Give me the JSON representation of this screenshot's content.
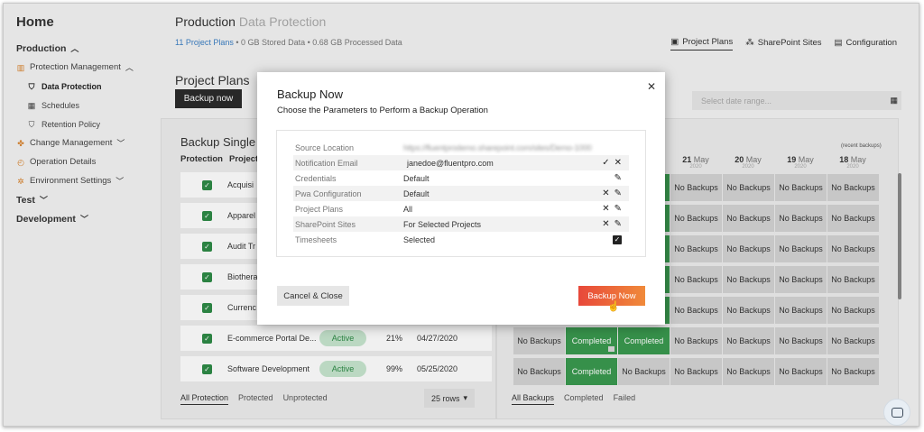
{
  "sidebar": {
    "home": "Home",
    "items": [
      {
        "label": "Production",
        "chevron": "up"
      },
      {
        "label": "Protection Management",
        "chevron": "up"
      },
      {
        "label": "Data Protection"
      },
      {
        "label": "Schedules"
      },
      {
        "label": "Retention Policy"
      },
      {
        "label": "Change Management",
        "chevron": "down"
      },
      {
        "label": "Operation Details"
      },
      {
        "label": "Environment Settings",
        "chevron": "down"
      },
      {
        "label": "Test",
        "chevron": "down"
      },
      {
        "label": "Development",
        "chevron": "down"
      }
    ]
  },
  "header": {
    "title": "Production",
    "subtitle": "Data Protection",
    "project_plans": "11 Project Plans",
    "stored": "• 0 GB Stored Data",
    "processed": "• 0.68 GB Processed Data",
    "tabs": [
      "Project Plans",
      "SharePoint Sites",
      "Configuration"
    ]
  },
  "main": {
    "section_title": "Project Plans",
    "backup_button": "Backup now",
    "date_placeholder": "Select date range...",
    "panel_title": "Backup Single",
    "col_protection": "Protection",
    "col_project": "Project",
    "recent": "(recent backups)",
    "projects": [
      {
        "name": "Acquisi"
      },
      {
        "name": "Apparel"
      },
      {
        "name": "Audit Tr"
      },
      {
        "name": "Biothera"
      },
      {
        "name": "Currenc"
      },
      {
        "name": "E-commerce Portal De...",
        "status": "Active",
        "pct": "21%",
        "date": "04/27/2020"
      },
      {
        "name": "Software Development",
        "status": "Active",
        "pct": "99%",
        "date": "05/25/2020"
      }
    ],
    "dates": [
      {
        "day": "21",
        "month": "May",
        "year": "2020"
      },
      {
        "day": "20",
        "month": "May",
        "year": "2020"
      },
      {
        "day": "19",
        "month": "May",
        "year": "2020"
      },
      {
        "day": "18",
        "month": "May",
        "year": "2020"
      }
    ],
    "no_backups": "No Backups",
    "completed": "Completed",
    "left_tabs": [
      "All Protection",
      "Protected",
      "Unprotected"
    ],
    "rows": "25 rows",
    "right_tabs": [
      "All Backups",
      "Completed",
      "Failed"
    ]
  },
  "modal": {
    "title": "Backup Now",
    "subtitle": "Choose the Parameters to Perform a Backup Operation",
    "params": [
      {
        "label": "Source Location",
        "value": "https://fluentprodemo.sharepoint.com/sites/Demo-1000"
      },
      {
        "label": "Notification Email",
        "value": "janedoe@fluentpro.com"
      },
      {
        "label": "Credentials",
        "value": "Default"
      },
      {
        "label": "Pwa Configuration",
        "value": "Default"
      },
      {
        "label": "Project Plans",
        "value": "All"
      },
      {
        "label": "SharePoint Sites",
        "value": "For Selected Projects"
      },
      {
        "label": "Timesheets",
        "value": "Selected"
      }
    ],
    "cancel": "Cancel & Close",
    "confirm": "Backup Now"
  }
}
